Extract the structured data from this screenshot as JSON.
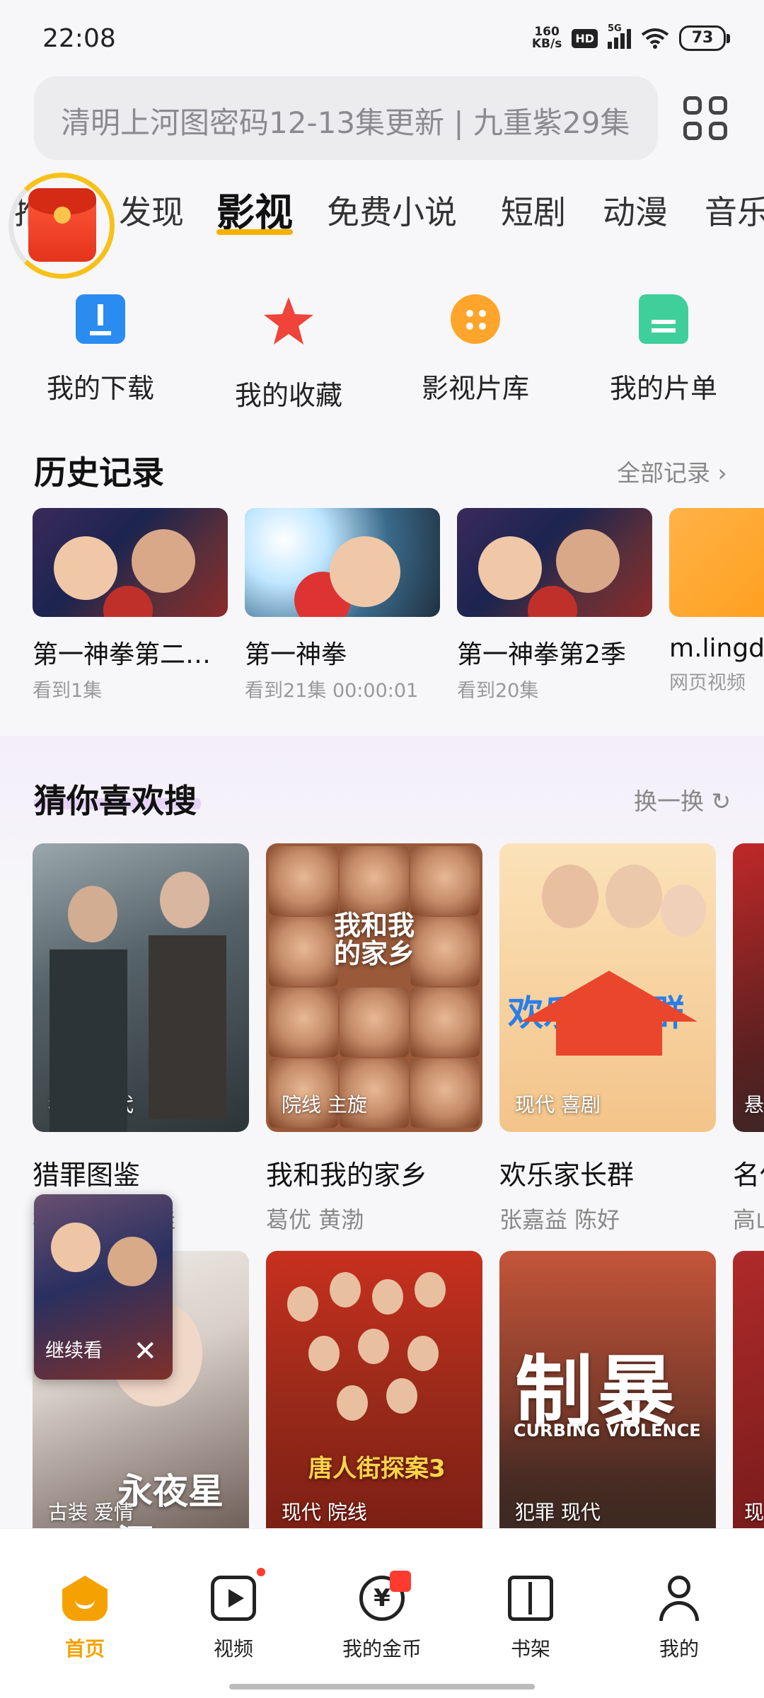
{
  "status_bar": {
    "time": "22:08",
    "net_speed_top": "160",
    "net_speed_unit": "KB/s",
    "hd": "HD",
    "network": "5G",
    "battery": "73"
  },
  "search": {
    "placeholder": "清明上河图密码12-13集更新 | 九重紫29集"
  },
  "tabs": [
    {
      "label": "推荐"
    },
    {
      "label": "发现"
    },
    {
      "label": "影视"
    },
    {
      "label": "免费小说"
    },
    {
      "label": "短剧"
    },
    {
      "label": "动漫"
    },
    {
      "label": "音乐"
    }
  ],
  "quick_actions": [
    {
      "label": "我的下载",
      "icon": "download-icon",
      "color": "#2a8cf0"
    },
    {
      "label": "我的收藏",
      "icon": "star-icon",
      "color": "#f0433a"
    },
    {
      "label": "影视片库",
      "icon": "film-reel-icon",
      "color": "#ffa52b"
    },
    {
      "label": "我的片单",
      "icon": "playlist-icon",
      "color": "#3ecf9a"
    }
  ],
  "history": {
    "title": "历史记录",
    "more": "全部记录",
    "items": [
      {
        "title": "第一神拳第二…",
        "sub": "看到1集"
      },
      {
        "title": "第一神拳",
        "sub": "看到21集 00:00:01"
      },
      {
        "title": "第一神拳第2季",
        "sub": "看到20集"
      },
      {
        "title": "m.lingdu",
        "sub": "网页视频"
      }
    ]
  },
  "recommend": {
    "title": "猜你喜欢搜",
    "refresh": "换一换",
    "row1": [
      {
        "name": "猎罪图鉴",
        "tag": "犯罪 现代",
        "cast": "檀健次 金世佳"
      },
      {
        "name": "我和我的家乡",
        "tag": "院线 主旋",
        "cast": "葛优 黄渤",
        "poster_text": "我和我的家乡"
      },
      {
        "name": "欢乐家长群",
        "tag": "现代 喜剧",
        "cast": "张嘉益 陈好",
        "poster_text": "欢乐家长群"
      },
      {
        "name": "名侦",
        "tag": "悬",
        "cast": "高山"
      }
    ],
    "row2": [
      {
        "tag": "古装 爱情",
        "poster_text": "永夜星河"
      },
      {
        "tag": "现代 院线",
        "poster_text": "唐人街探案3"
      },
      {
        "tag": "犯罪 现代",
        "poster_text": "制暴",
        "poster_sub": "CURBING VIOLENCE"
      },
      {
        "tag": "现"
      }
    ]
  },
  "continue_watching": {
    "label": "继续看",
    "close": "✕"
  },
  "bottom_nav": [
    {
      "label": "首页",
      "icon": "home-icon",
      "active": true
    },
    {
      "label": "视频",
      "icon": "video-icon"
    },
    {
      "label": "我的金币",
      "icon": "coin-icon",
      "glyph": "¥"
    },
    {
      "label": "书架",
      "icon": "bookshelf-icon"
    },
    {
      "label": "我的",
      "icon": "profile-icon"
    }
  ],
  "colors": {
    "accent": "#f5a200",
    "tab_underline": "#f5b100",
    "text_primary": "#111111",
    "text_secondary": "#888888"
  }
}
